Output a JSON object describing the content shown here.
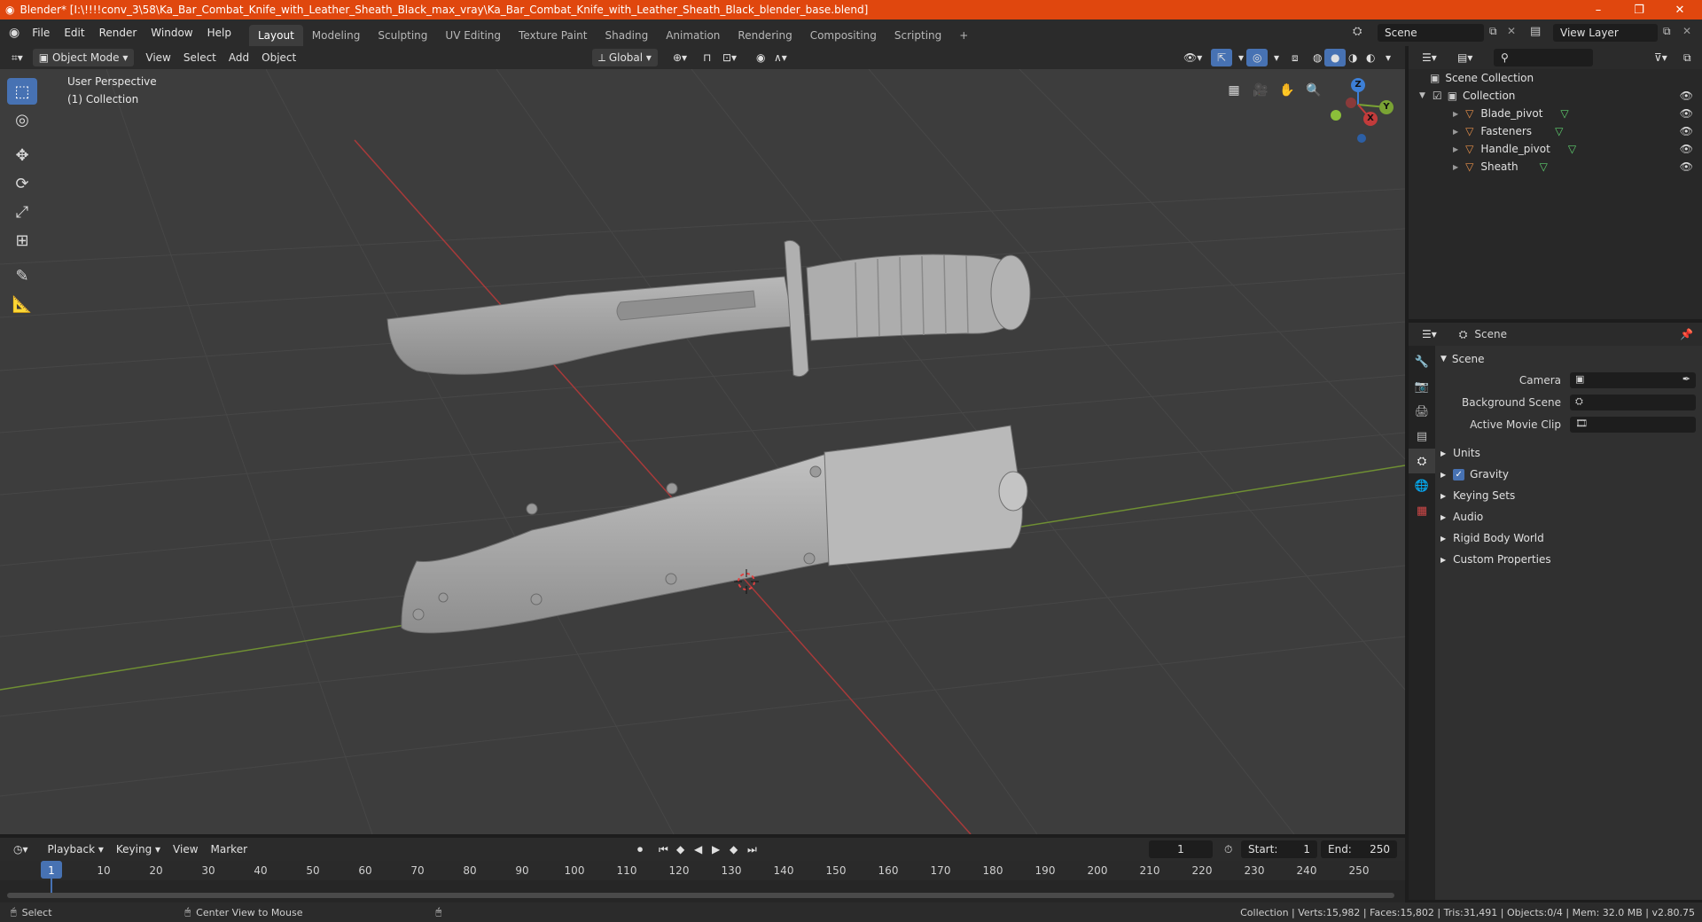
{
  "window": {
    "title": "Blender* [I:\\!!!!conv_3\\58\\Ka_Bar_Combat_Knife_with_Leather_Sheath_Black_max_vray\\Ka_Bar_Combat_Knife_with_Leather_Sheath_Black_blender_base.blend]",
    "minimize": "–",
    "maximize": "❐",
    "close": "✕"
  },
  "menu": {
    "file": "File",
    "edit": "Edit",
    "render": "Render",
    "window": "Window",
    "help": "Help"
  },
  "workspaces": [
    "Layout",
    "Modeling",
    "Sculpting",
    "UV Editing",
    "Texture Paint",
    "Shading",
    "Animation",
    "Rendering",
    "Compositing",
    "Scripting"
  ],
  "workspace_add": "+",
  "scene_selector": {
    "value": "Scene"
  },
  "view_layer_selector": {
    "value": "View Layer"
  },
  "viewport_header": {
    "mode": "Object Mode",
    "view": "View",
    "select": "Select",
    "add": "Add",
    "object": "Object",
    "transform_orientation": "Global"
  },
  "viewport": {
    "perspective": "User Perspective",
    "collection": "(1) Collection",
    "gizmo_z": "Z",
    "gizmo_y": "Y",
    "gizmo_x": "X"
  },
  "outliner": {
    "root": "Scene Collection",
    "collection": "Collection",
    "items": [
      "Blade_pivot",
      "Fasteners",
      "Handle_pivot",
      "Sheath"
    ]
  },
  "properties": {
    "header_scene": "Scene",
    "panel_scene": "Scene",
    "camera_label": "Camera",
    "background_scene_label": "Background Scene",
    "active_movie_clip_label": "Active Movie Clip",
    "panels": [
      "Units",
      "Gravity",
      "Keying Sets",
      "Audio",
      "Rigid Body World",
      "Custom Properties"
    ],
    "gravity_checked": true
  },
  "timeline": {
    "playback": "Playback",
    "keying": "Keying",
    "view": "View",
    "marker": "Marker",
    "current_frame": "1",
    "start_label": "Start:",
    "start_value": "1",
    "end_label": "End:",
    "end_value": "250",
    "ticks": [
      "1",
      "10",
      "20",
      "30",
      "40",
      "50",
      "60",
      "70",
      "80",
      "90",
      "100",
      "110",
      "120",
      "130",
      "140",
      "150",
      "160",
      "170",
      "180",
      "190",
      "200",
      "210",
      "220",
      "230",
      "240",
      "250"
    ]
  },
  "status": {
    "select": "Select",
    "center_view": "Center View to Mouse",
    "stats": "Collection | Verts:15,982 | Faces:15,802 | Tris:31,491 | Objects:0/4 | Mem: 32.0 MB | v2.80.75"
  },
  "colors": {
    "titlebar": "#e0470e",
    "accent": "#4772b3",
    "x_axis": "#c23b3b",
    "y_axis": "#7aa334",
    "z_axis": "#3d7fd6"
  }
}
